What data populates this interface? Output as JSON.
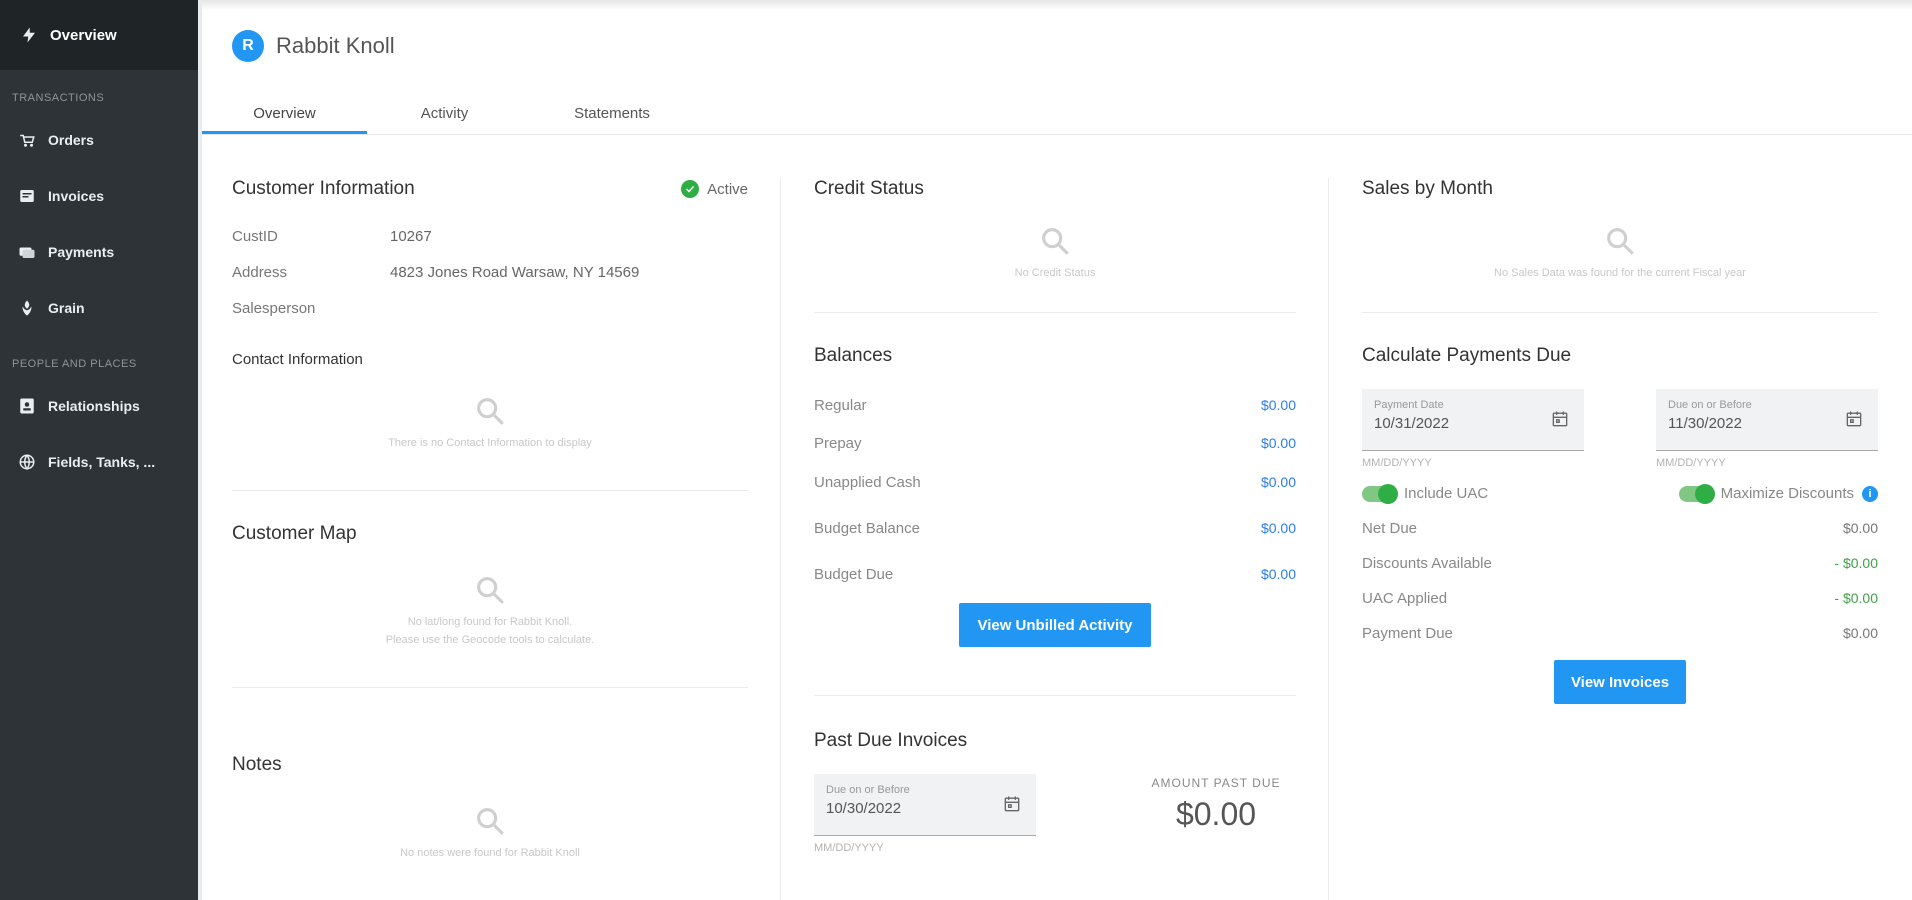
{
  "sidebar": {
    "overview": "Overview",
    "section_transactions": "TRANSACTIONS",
    "orders": "Orders",
    "invoices": "Invoices",
    "payments": "Payments",
    "grain": "Grain",
    "section_people": "PEOPLE AND PLACES",
    "relationships": "Relationships",
    "fields": "Fields, Tanks, ..."
  },
  "header": {
    "avatar": "R",
    "name": "Rabbit Knoll"
  },
  "tabs": {
    "overview": "Overview",
    "activity": "Activity",
    "statements": "Statements"
  },
  "customer_info": {
    "title": "Customer Information",
    "status": "Active",
    "custid_label": "CustID",
    "custid_value": "10267",
    "address_label": "Address",
    "address_value": "4823 Jones Road Warsaw, NY 14569",
    "salesperson_label": "Salesperson",
    "contact_title": "Contact Information",
    "contact_empty": "There is no Contact Information to display"
  },
  "customer_map": {
    "title": "Customer Map",
    "empty_line1": "No lat/long found for Rabbit Knoll.",
    "empty_line2": "Please use the Geocode tools to calculate."
  },
  "notes": {
    "title": "Notes",
    "empty": "No notes were found for Rabbit Knoll"
  },
  "credit_status": {
    "title": "Credit Status",
    "empty": "No Credit Status"
  },
  "balances": {
    "title": "Balances",
    "regular_label": "Regular",
    "regular_value": "$0.00",
    "prepay_label": "Prepay",
    "prepay_value": "$0.00",
    "unapplied_label": "Unapplied Cash",
    "unapplied_value": "$0.00",
    "budget_balance_label": "Budget Balance",
    "budget_balance_value": "$0.00",
    "budget_due_label": "Budget Due",
    "budget_due_value": "$0.00",
    "button": "View Unbilled Activity"
  },
  "past_due": {
    "title": "Past Due Invoices",
    "date_label": "Due on or Before",
    "date_value": "10/30/2022",
    "hint": "MM/DD/YYYY",
    "amount_label": "AMOUNT PAST DUE",
    "amount_value": "$0.00"
  },
  "sales_by_month": {
    "title": "Sales by Month",
    "empty": "No Sales Data was found for the current Fiscal year"
  },
  "calc_payments": {
    "title": "Calculate Payments Due",
    "payment_date_label": "Payment Date",
    "payment_date_value": "10/31/2022",
    "due_label": "Due on or Before",
    "due_value": "11/30/2022",
    "hint": "MM/DD/YYYY",
    "include_uac": "Include UAC",
    "maximize_discounts": "Maximize Discounts",
    "info": "i",
    "net_due_label": "Net Due",
    "net_due_value": "$0.00",
    "discounts_label": "Discounts Available",
    "discounts_value": "- $0.00",
    "uac_label": "UAC Applied",
    "uac_value": "- $0.00",
    "payment_due_label": "Payment Due",
    "payment_due_value": "$0.00",
    "button": "View Invoices"
  }
}
